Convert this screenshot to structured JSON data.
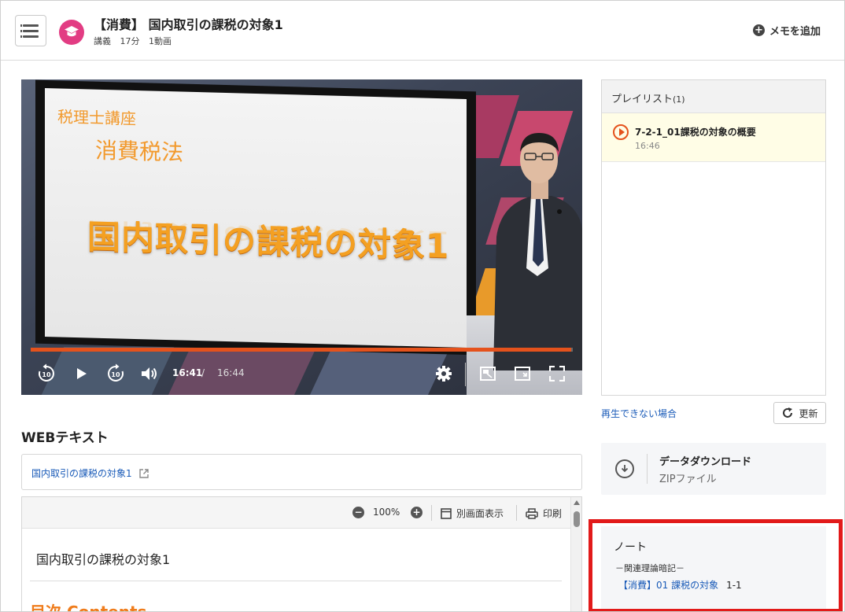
{
  "header": {
    "title": "【消費】 国内取引の課税の対象1",
    "meta": [
      "講義",
      "17分",
      "1動画"
    ],
    "memo_label": "メモを追加"
  },
  "video": {
    "slide_line1": "税理士講座",
    "slide_line2": "消費税法",
    "slide_title": "国内取引の課税の対象1",
    "current_time": "16:41",
    "time_separator": "/",
    "duration": "16:44",
    "progress": 0.997,
    "accent_color": "#e5521c"
  },
  "web_text": {
    "heading": "WEBテキスト",
    "link_label": "国内取引の課税の対象1",
    "zoom": "100%",
    "separate_window_label": "別画面表示",
    "print_label": "印刷",
    "doc_title": "国内取引の課税の対象1",
    "doc_toc": "目次 Contents"
  },
  "playlist": {
    "heading": "プレイリスト",
    "count": "(1)",
    "items": [
      {
        "title": "7-2-1_01課税の対象の概要",
        "time": "16:46"
      }
    ],
    "cant_play_label": "再生できない場合",
    "refresh_label": "更新"
  },
  "download": {
    "title": "データダウンロード",
    "subtitle": "ZIPファイル"
  },
  "note": {
    "title": "ノート",
    "subtitle": "－関連理論暗記－",
    "link_label": "【消費】01 課税の対象",
    "link_number": "1-1",
    "highlight_color": "#e21a1a"
  }
}
